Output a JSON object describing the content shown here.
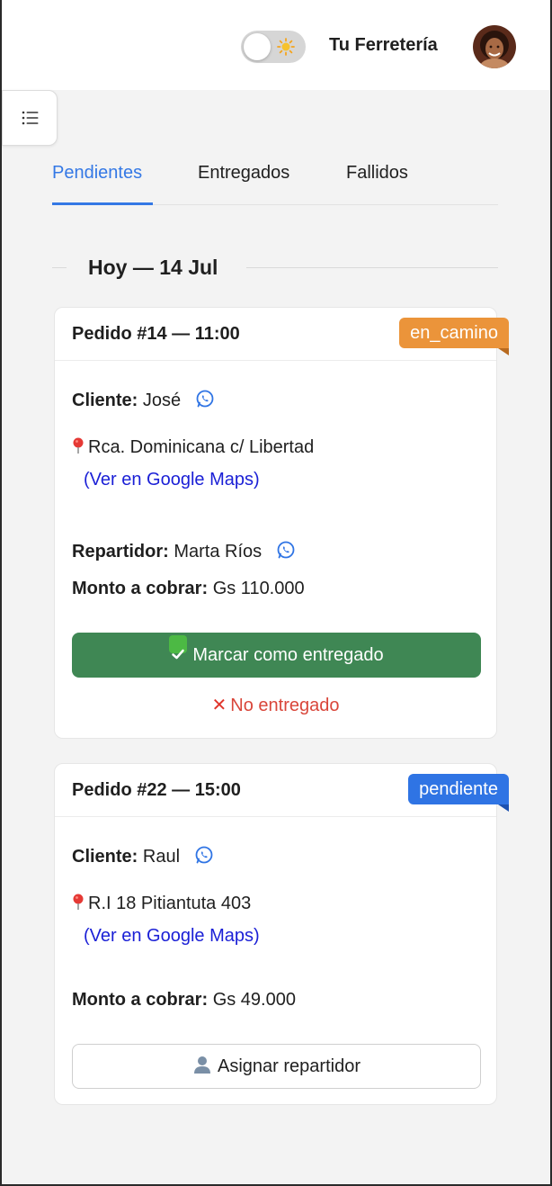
{
  "header": {
    "brand": "Tu Ferretería",
    "theme_toggle_icon": "sun-icon",
    "avatar_icon": "user-avatar"
  },
  "menu": {
    "icon": "list-icon"
  },
  "tabs": [
    {
      "label": "Pendientes",
      "active": true
    },
    {
      "label": "Entregados",
      "active": false
    },
    {
      "label": "Fallidos",
      "active": false
    }
  ],
  "date_group": "Hoy — 14 Jul",
  "labels": {
    "cliente": "Cliente:",
    "repartidor": "Repartidor:",
    "monto": "Monto a cobrar:",
    "maps": "(Ver en Google Maps)"
  },
  "orders": [
    {
      "title": "Pedido #14 — 11:00",
      "status": "en_camino",
      "status_color": "#eb943a",
      "client": "José",
      "address": "Rca. Dominicana c/ Libertad",
      "courier": "Marta Ríos",
      "amount": "Gs 110.000",
      "primary_action": "Marcar como entregado",
      "secondary_action": "No entregado"
    },
    {
      "title": "Pedido #22 — 15:00",
      "status": "pendiente",
      "status_color": "#2f74e4",
      "client": "Raul",
      "address": "R.I 18 Pitiantuta 403",
      "amount": "Gs 49.000",
      "primary_action": "Asignar repartidor"
    }
  ]
}
